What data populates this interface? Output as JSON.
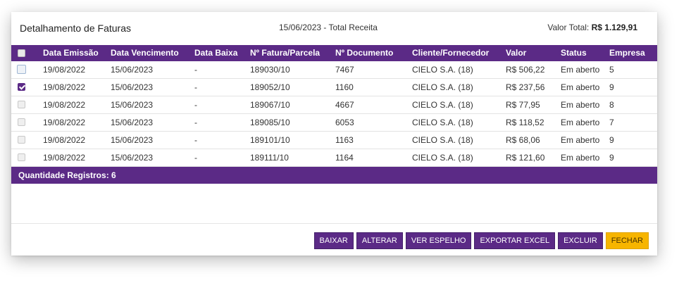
{
  "header": {
    "title": "Detalhamento de Faturas",
    "subtitle": "15/06/2023 - Total Receita",
    "total_label": "Valor Total:",
    "total_value": "R$ 1.129,91"
  },
  "table": {
    "columns": [
      "Data Emissão",
      "Data Vencimento",
      "Data Baixa",
      "Nº Fatura/Parcela",
      "Nº Documento",
      "Cliente/Fornecedor",
      "Valor",
      "Status",
      "Empresa"
    ],
    "rows": [
      {
        "checked": false,
        "cells": [
          "19/08/2022",
          "15/06/2023",
          "-",
          "189030/10",
          "7467",
          "CIELO S.A. (18)",
          "R$ 506,22",
          "Em aberto",
          "5"
        ]
      },
      {
        "checked": true,
        "cells": [
          "19/08/2022",
          "15/06/2023",
          "-",
          "189052/10",
          "1160",
          "CIELO S.A. (18)",
          "R$ 237,56",
          "Em aberto",
          "9"
        ]
      },
      {
        "checked": false,
        "cells": [
          "19/08/2022",
          "15/06/2023",
          "-",
          "189067/10",
          "4667",
          "CIELO S.A. (18)",
          "R$ 77,95",
          "Em aberto",
          "8"
        ]
      },
      {
        "checked": false,
        "cells": [
          "19/08/2022",
          "15/06/2023",
          "-",
          "189085/10",
          "6053",
          "CIELO S.A. (18)",
          "R$ 118,52",
          "Em aberto",
          "7"
        ]
      },
      {
        "checked": false,
        "cells": [
          "19/08/2022",
          "15/06/2023",
          "-",
          "189101/10",
          "1163",
          "CIELO S.A. (18)",
          "R$ 68,06",
          "Em aberto",
          "9"
        ]
      },
      {
        "checked": false,
        "cells": [
          "19/08/2022",
          "15/06/2023",
          "-",
          "189111/10",
          "1164",
          "CIELO S.A. (18)",
          "R$ 121,60",
          "Em aberto",
          "9"
        ]
      }
    ]
  },
  "footer": {
    "count_label": "Quantidade Registros: 6"
  },
  "buttons": {
    "baixar": "BAIXAR",
    "alterar": "ALTERAR",
    "ver_espelho": "VER ESPELHO",
    "exportar_excel": "EXPORTAR EXCEL",
    "excluir": "EXCLUIR",
    "fechar": "FECHAR"
  },
  "colors": {
    "primary": "#5b2a86",
    "accent": "#f7b500"
  }
}
